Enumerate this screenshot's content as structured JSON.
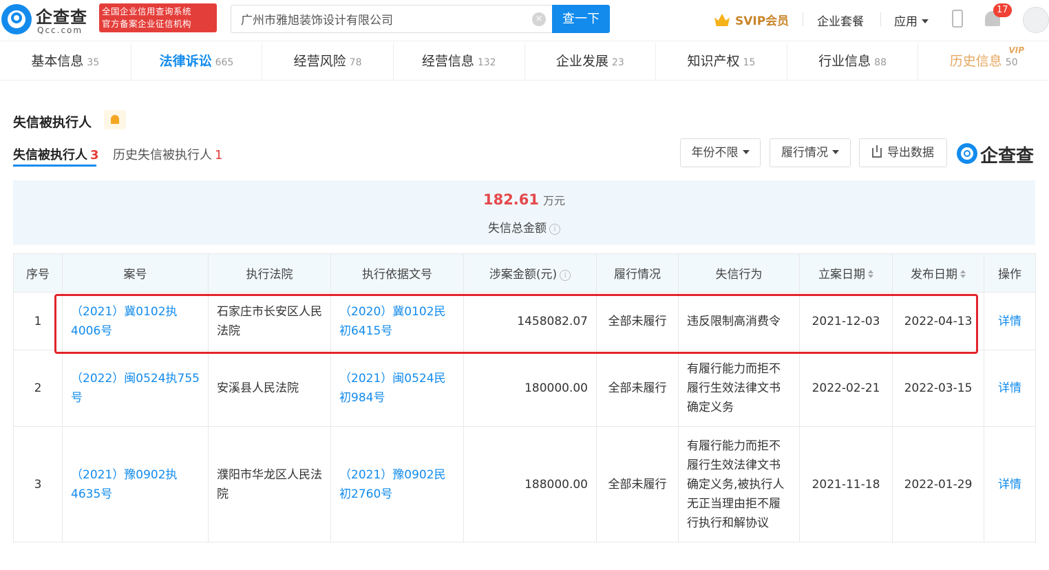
{
  "header": {
    "logo_name": "企查查",
    "logo_domain": "Qcc.com",
    "badge_line1": "全国企业信用查询系统",
    "badge_line2": "官方备案企业征信机构",
    "search_value": "广州市雅旭装饰设计有限公司",
    "search_button": "查一下",
    "clear_glyph": "×",
    "svip_label": "SVIP会员",
    "package_label": "企业套餐",
    "apps_label": "应用",
    "notification_count": "17"
  },
  "nav": {
    "tabs": [
      {
        "label": "基本信息",
        "count": "35"
      },
      {
        "label": "法律诉讼",
        "count": "665"
      },
      {
        "label": "经营风险",
        "count": "78"
      },
      {
        "label": "经营信息",
        "count": "132"
      },
      {
        "label": "企业发展",
        "count": "23"
      },
      {
        "label": "知识产权",
        "count": "15"
      },
      {
        "label": "行业信息",
        "count": "88"
      },
      {
        "label": "历史信息",
        "count": "50"
      }
    ],
    "vip_tag": "VIP",
    "active_index": 1
  },
  "section": {
    "title": "失信被执行人",
    "subtabs": [
      {
        "label": "失信被执行人",
        "count": "3"
      },
      {
        "label": "历史失信被执行人",
        "count": "1"
      }
    ],
    "filters": {
      "year": "年份不限",
      "status": "履行情况",
      "export": "导出数据"
    },
    "watermark": "企查查"
  },
  "summary": {
    "amount": "182.61",
    "unit": "万元",
    "label": "失信总金额",
    "info_glyph": "i"
  },
  "table": {
    "headers": [
      "序号",
      "案号",
      "执行法院",
      "执行依据文号",
      "涉案金额(元)",
      "履行情况",
      "失信行为",
      "立案日期",
      "发布日期",
      "操作"
    ],
    "rows": [
      {
        "no": "1",
        "case_no": "（2021）冀0102执4006号",
        "court": "石家庄市长安区人民法院",
        "basis_no": "（2020）冀0102民初6415号",
        "amount": "1458082.07",
        "status": "全部未履行",
        "behavior": "违反限制高消费令",
        "filed_date": "2021-12-03",
        "publish_date": "2022-04-13",
        "action": "详情"
      },
      {
        "no": "2",
        "case_no": "（2022）闽0524执755号",
        "court": "安溪县人民法院",
        "basis_no": "（2021）闽0524民初984号",
        "amount": "180000.00",
        "status": "全部未履行",
        "behavior": "有履行能力而拒不履行生效法律文书确定义务",
        "filed_date": "2022-02-21",
        "publish_date": "2022-03-15",
        "action": "详情"
      },
      {
        "no": "3",
        "case_no": "（2021）豫0902执4635号",
        "court": "濮阳市华龙区人民法院",
        "basis_no": "（2021）豫0902民初2760号",
        "amount": "188000.00",
        "status": "全部未履行",
        "behavior": "有履行能力而拒不履行生效法律文书确定义务,被执行人无正当理由拒不履行执行和解协议",
        "filed_date": "2021-11-18",
        "publish_date": "2022-01-29",
        "action": "详情"
      }
    ]
  },
  "colors": {
    "brand_blue": "#128bed",
    "badge_red": "#e43e3a",
    "amount_red": "#e4484b",
    "highlight_red": "#e3242b",
    "vip_gold": "#e6a760"
  }
}
